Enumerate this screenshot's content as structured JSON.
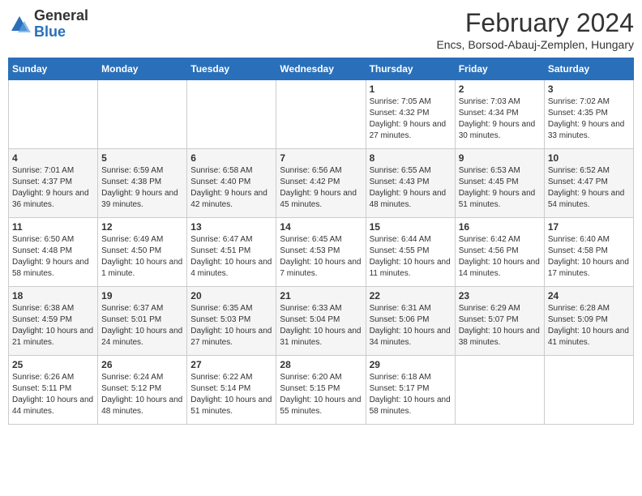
{
  "header": {
    "logo_general": "General",
    "logo_blue": "Blue",
    "month_title": "February 2024",
    "subtitle": "Encs, Borsod-Abauj-Zemplen, Hungary"
  },
  "days_of_week": [
    "Sunday",
    "Monday",
    "Tuesday",
    "Wednesday",
    "Thursday",
    "Friday",
    "Saturday"
  ],
  "weeks": [
    [
      {
        "day": "",
        "sunrise": "",
        "sunset": "",
        "daylight": ""
      },
      {
        "day": "",
        "sunrise": "",
        "sunset": "",
        "daylight": ""
      },
      {
        "day": "",
        "sunrise": "",
        "sunset": "",
        "daylight": ""
      },
      {
        "day": "",
        "sunrise": "",
        "sunset": "",
        "daylight": ""
      },
      {
        "day": "1",
        "sunrise": "Sunrise: 7:05 AM",
        "sunset": "Sunset: 4:32 PM",
        "daylight": "Daylight: 9 hours and 27 minutes."
      },
      {
        "day": "2",
        "sunrise": "Sunrise: 7:03 AM",
        "sunset": "Sunset: 4:34 PM",
        "daylight": "Daylight: 9 hours and 30 minutes."
      },
      {
        "day": "3",
        "sunrise": "Sunrise: 7:02 AM",
        "sunset": "Sunset: 4:35 PM",
        "daylight": "Daylight: 9 hours and 33 minutes."
      }
    ],
    [
      {
        "day": "4",
        "sunrise": "Sunrise: 7:01 AM",
        "sunset": "Sunset: 4:37 PM",
        "daylight": "Daylight: 9 hours and 36 minutes."
      },
      {
        "day": "5",
        "sunrise": "Sunrise: 6:59 AM",
        "sunset": "Sunset: 4:38 PM",
        "daylight": "Daylight: 9 hours and 39 minutes."
      },
      {
        "day": "6",
        "sunrise": "Sunrise: 6:58 AM",
        "sunset": "Sunset: 4:40 PM",
        "daylight": "Daylight: 9 hours and 42 minutes."
      },
      {
        "day": "7",
        "sunrise": "Sunrise: 6:56 AM",
        "sunset": "Sunset: 4:42 PM",
        "daylight": "Daylight: 9 hours and 45 minutes."
      },
      {
        "day": "8",
        "sunrise": "Sunrise: 6:55 AM",
        "sunset": "Sunset: 4:43 PM",
        "daylight": "Daylight: 9 hours and 48 minutes."
      },
      {
        "day": "9",
        "sunrise": "Sunrise: 6:53 AM",
        "sunset": "Sunset: 4:45 PM",
        "daylight": "Daylight: 9 hours and 51 minutes."
      },
      {
        "day": "10",
        "sunrise": "Sunrise: 6:52 AM",
        "sunset": "Sunset: 4:47 PM",
        "daylight": "Daylight: 9 hours and 54 minutes."
      }
    ],
    [
      {
        "day": "11",
        "sunrise": "Sunrise: 6:50 AM",
        "sunset": "Sunset: 4:48 PM",
        "daylight": "Daylight: 9 hours and 58 minutes."
      },
      {
        "day": "12",
        "sunrise": "Sunrise: 6:49 AM",
        "sunset": "Sunset: 4:50 PM",
        "daylight": "Daylight: 10 hours and 1 minute."
      },
      {
        "day": "13",
        "sunrise": "Sunrise: 6:47 AM",
        "sunset": "Sunset: 4:51 PM",
        "daylight": "Daylight: 10 hours and 4 minutes."
      },
      {
        "day": "14",
        "sunrise": "Sunrise: 6:45 AM",
        "sunset": "Sunset: 4:53 PM",
        "daylight": "Daylight: 10 hours and 7 minutes."
      },
      {
        "day": "15",
        "sunrise": "Sunrise: 6:44 AM",
        "sunset": "Sunset: 4:55 PM",
        "daylight": "Daylight: 10 hours and 11 minutes."
      },
      {
        "day": "16",
        "sunrise": "Sunrise: 6:42 AM",
        "sunset": "Sunset: 4:56 PM",
        "daylight": "Daylight: 10 hours and 14 minutes."
      },
      {
        "day": "17",
        "sunrise": "Sunrise: 6:40 AM",
        "sunset": "Sunset: 4:58 PM",
        "daylight": "Daylight: 10 hours and 17 minutes."
      }
    ],
    [
      {
        "day": "18",
        "sunrise": "Sunrise: 6:38 AM",
        "sunset": "Sunset: 4:59 PM",
        "daylight": "Daylight: 10 hours and 21 minutes."
      },
      {
        "day": "19",
        "sunrise": "Sunrise: 6:37 AM",
        "sunset": "Sunset: 5:01 PM",
        "daylight": "Daylight: 10 hours and 24 minutes."
      },
      {
        "day": "20",
        "sunrise": "Sunrise: 6:35 AM",
        "sunset": "Sunset: 5:03 PM",
        "daylight": "Daylight: 10 hours and 27 minutes."
      },
      {
        "day": "21",
        "sunrise": "Sunrise: 6:33 AM",
        "sunset": "Sunset: 5:04 PM",
        "daylight": "Daylight: 10 hours and 31 minutes."
      },
      {
        "day": "22",
        "sunrise": "Sunrise: 6:31 AM",
        "sunset": "Sunset: 5:06 PM",
        "daylight": "Daylight: 10 hours and 34 minutes."
      },
      {
        "day": "23",
        "sunrise": "Sunrise: 6:29 AM",
        "sunset": "Sunset: 5:07 PM",
        "daylight": "Daylight: 10 hours and 38 minutes."
      },
      {
        "day": "24",
        "sunrise": "Sunrise: 6:28 AM",
        "sunset": "Sunset: 5:09 PM",
        "daylight": "Daylight: 10 hours and 41 minutes."
      }
    ],
    [
      {
        "day": "25",
        "sunrise": "Sunrise: 6:26 AM",
        "sunset": "Sunset: 5:11 PM",
        "daylight": "Daylight: 10 hours and 44 minutes."
      },
      {
        "day": "26",
        "sunrise": "Sunrise: 6:24 AM",
        "sunset": "Sunset: 5:12 PM",
        "daylight": "Daylight: 10 hours and 48 minutes."
      },
      {
        "day": "27",
        "sunrise": "Sunrise: 6:22 AM",
        "sunset": "Sunset: 5:14 PM",
        "daylight": "Daylight: 10 hours and 51 minutes."
      },
      {
        "day": "28",
        "sunrise": "Sunrise: 6:20 AM",
        "sunset": "Sunset: 5:15 PM",
        "daylight": "Daylight: 10 hours and 55 minutes."
      },
      {
        "day": "29",
        "sunrise": "Sunrise: 6:18 AM",
        "sunset": "Sunset: 5:17 PM",
        "daylight": "Daylight: 10 hours and 58 minutes."
      },
      {
        "day": "",
        "sunrise": "",
        "sunset": "",
        "daylight": ""
      },
      {
        "day": "",
        "sunrise": "",
        "sunset": "",
        "daylight": ""
      }
    ]
  ]
}
